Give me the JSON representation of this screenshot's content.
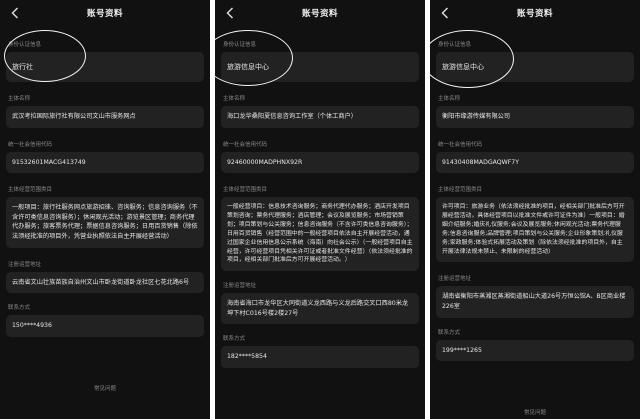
{
  "panels": [
    {
      "nav_title": "账号资料",
      "identity_label": "身份认证信息",
      "identity_value": "旅行社",
      "entity_label": "主体名称",
      "entity_value": "武汉考拉国际旅行社有限公司文山市服务网点",
      "credit_label": "统一社会信用代码",
      "credit_value": "91532601MACG413749",
      "scope_label": "主体经营范围类目",
      "scope_value": "一般项目：旅行社服务网点旅游招徕、咨询服务；信息咨询服务（不含许可类信息咨询服务）；休闲观光活动；游览景区管理；商务代理代办服务；旅客票务代理；票据信息咨询服务；日用百货销售（除依法须经批准的项目外，凭营业执照依法自主开展经营活动）",
      "address_label": "注册运营地址",
      "address_value": "云南省文山壮族苗族自治州文山市卧龙街道卧龙社区七花北路6号",
      "contact_label": "联系方式",
      "contact_value": "150****4936",
      "faq": "常见问题"
    },
    {
      "nav_title": "账号资料",
      "identity_label": "身份认证信息",
      "identity_value": "旅游信息中心",
      "entity_label": "主体名称",
      "entity_value": "海口龙华桑阳夏信息咨询工作室（个体工商户）",
      "credit_label": "统一社会信用代码",
      "credit_value": "92460000MADPHNX92R",
      "scope_label": "主体经营范围类目",
      "scope_value": "一般经营项目：信息技术咨询服务；商务代理代办服务；酒店开发项目策划咨询；票务代理服务；酒店管理；会议及展览服务；市场营销策划；项目策划与公关服务；信息咨询服务（不含许可类信息咨询服务）；日用百货销售（经营范围中的一般经营项目依法自主开展经营活动，通过国家企业信用信息公示系统（海南）向社会公示）（一般经营项目自主经营，许可经营项目凭相关许可证或者批准文件经营）（依法须经批准的项目，经相关部门批准后方可开展经营活动。）",
      "address_label": "注册运营地址",
      "address_value": "海南省海口市龙华区大同街道义龙西路与义龙后路交叉口西80米龙坤下村C016号楼2楼27号",
      "contact_label": "联系方式",
      "contact_value": "182****5854",
      "faq": ""
    },
    {
      "nav_title": "账号资料",
      "identity_label": "身份认证信息",
      "identity_value": "旅游信息中心",
      "entity_label": "主体名称",
      "entity_value": "衡阳市缘游传媒有限公司",
      "credit_label": "统一社会信用代码",
      "credit_value": "91430408MADGAQWF7Y",
      "scope_label": "主体经营范围类目",
      "scope_value": "许可项目：旅游业务（依法须经批准的项目，经相关部门批准后方可开展经营活动，具体经营项目以批准文件或许可证件为准）一般项目：婚姻介绍服务;婚庆礼仪服务;会议及展览服务;休闲观光活动;票务代理服务;信息咨询服务;品牌管理;项目策划与公关服务;企业形象策划;礼仪服务;家政服务;体验式拓展活动及策划（除依法须经批准的项目外，自主开展法律法规未禁止、未限制的经营活动）",
      "address_label": "注册运营地址",
      "address_value": "湖南省衡阳市蒸湘区蒸湘街道船山大道26号万恒公馆A、B区商业楼226室",
      "contact_label": "联系方式",
      "contact_value": "199****1265",
      "faq": "常见问题"
    }
  ],
  "colors": {
    "background": "#111111",
    "field_box": "#222222",
    "label": "#8a8a8a",
    "value": "#e8e8e8",
    "annotation": "#f5f5f5"
  },
  "icons": {
    "back": "chevron-left-icon"
  }
}
